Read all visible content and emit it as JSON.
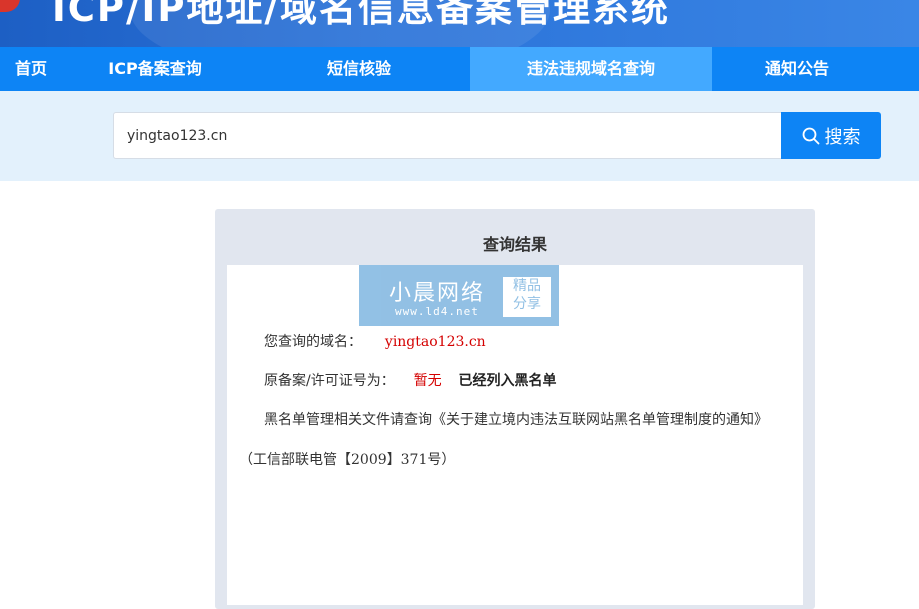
{
  "banner": {
    "title": "ICP/IP地址/域名信息备案管理系统"
  },
  "nav": {
    "items": [
      {
        "label": "首页"
      },
      {
        "label": "ICP备案查询"
      },
      {
        "label": "短信核验"
      },
      {
        "label": "违法违规域名查询"
      },
      {
        "label": "通知公告"
      }
    ],
    "active_index": 3
  },
  "search": {
    "value": "yingtao123.cn",
    "button_label": "搜索",
    "button_icon": "search-icon"
  },
  "result": {
    "title": "查询结果",
    "watermark": {
      "main": "小晨网络",
      "url": "www.ld4.net",
      "box_line1": "精品",
      "box_line2": "分享"
    },
    "domain_label": "您查询的域名：",
    "domain_value": "yingtao123.cn",
    "license_label": "原备案/许可证号为：",
    "license_value": "暂无",
    "blacklist_status": "已经列入黑名单",
    "notice_text": "黑名单管理相关文件请查询《关于建立境内违法互联网站黑名单管理制度的通知》",
    "notice_ref": "（工信部联电管【2009】371号）"
  },
  "colors": {
    "nav_bg": "#0d84f5",
    "nav_active": "#43a9ff",
    "accent_red": "#d40000"
  }
}
